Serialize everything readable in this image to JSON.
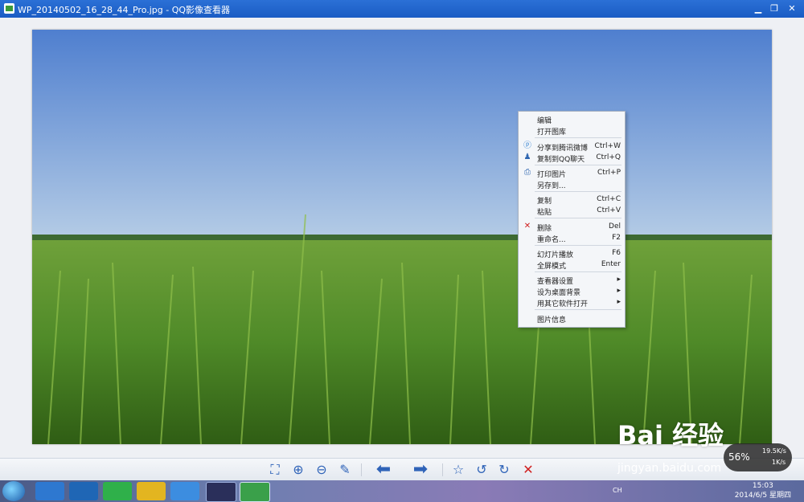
{
  "window": {
    "title": "WP_20140502_16_28_44_Pro.jpg - QQ影像查看器",
    "minimize": "▁",
    "restore": "❐",
    "close": "✕"
  },
  "context_menu": {
    "items": [
      {
        "label": "编辑",
        "shortcut": ""
      },
      {
        "label": "打开图库",
        "shortcut": ""
      },
      {
        "label": "分享到腾讯微博",
        "shortcut": "Ctrl+W"
      },
      {
        "label": "复制到QQ聊天",
        "shortcut": "Ctrl+Q"
      },
      {
        "label": "打印图片",
        "shortcut": "Ctrl+P"
      },
      {
        "label": "另存到...",
        "shortcut": ""
      },
      {
        "label": "复制",
        "shortcut": "Ctrl+C"
      },
      {
        "label": "粘贴",
        "shortcut": "Ctrl+V"
      },
      {
        "label": "删除",
        "shortcut": "Del"
      },
      {
        "label": "重命名...",
        "shortcut": "F2"
      },
      {
        "label": "幻灯片播放",
        "shortcut": "F6"
      },
      {
        "label": "全屏模式",
        "shortcut": "Enter"
      },
      {
        "label": "查看器设置",
        "shortcut": "▸"
      },
      {
        "label": "设为桌面背景",
        "shortcut": "▸"
      },
      {
        "label": "用其它软件打开",
        "shortcut": "▸"
      },
      {
        "label": "图片信息",
        "shortcut": ""
      }
    ]
  },
  "toolbar": {
    "icons": [
      "fit-icon",
      "zoom-in-icon",
      "zoom-out-icon",
      "brush-icon",
      "prev-arrow-icon",
      "next-arrow-icon",
      "star-icon",
      "rotate-left-icon",
      "rotate-right-icon",
      "delete-icon"
    ]
  },
  "taskbar": {
    "lang": "CH",
    "time": "15:03",
    "date": "2014/6/5 星期四"
  },
  "network": {
    "up": "19.5K/s",
    "down": "1K/s",
    "percent": "56%"
  },
  "watermark": {
    "brand": "Bai 经验",
    "url": "jingyan.baidu.com"
  }
}
